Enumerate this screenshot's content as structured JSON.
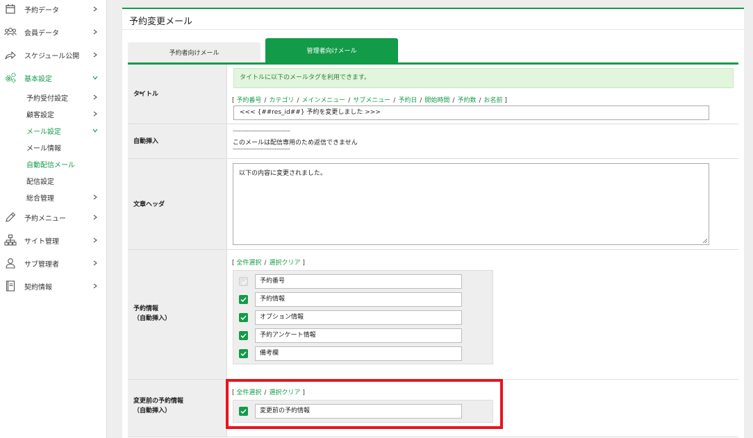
{
  "sidebar": {
    "items": [
      {
        "label": "予約データ",
        "icon": "calendar-icon"
      },
      {
        "label": "会員データ",
        "icon": "users-icon"
      },
      {
        "label": "スケジュール公開",
        "icon": "share-icon"
      },
      {
        "label": "基本設定",
        "icon": "gears-icon"
      },
      {
        "label": "予約メニュー",
        "icon": "pencil-icon"
      },
      {
        "label": "サイト管理",
        "icon": "sitemap-icon"
      },
      {
        "label": "サブ管理者",
        "icon": "user-icon"
      },
      {
        "label": "契約情報",
        "icon": "book-icon"
      }
    ],
    "sub_items": [
      {
        "label": "予約受付設定"
      },
      {
        "label": "顧客設定"
      },
      {
        "label": "メール設定"
      },
      {
        "label": "メール情報"
      },
      {
        "label": "自動配信メール"
      },
      {
        "label": "配信設定"
      },
      {
        "label": "総合管理"
      }
    ]
  },
  "panel": {
    "title": "予約変更メール",
    "tabs": {
      "user": "予約者向けメール",
      "admin": "管理者向けメール"
    }
  },
  "form": {
    "title": {
      "required_mark": "*",
      "label": "タイトル",
      "notice": "タイトルに以下のメールタグを利用できます。",
      "tags": [
        "予約番号",
        "カテゴリ",
        "メインメニュー",
        "サブメニュー",
        "予約日",
        "開始時間",
        "予約数",
        "お名前"
      ],
      "value": "<<< {##res_id##} 予約を変更しました >>>"
    },
    "auto_insert": {
      "label": "自動挿入",
      "dash": "------------------------------",
      "text": "このメールは配信専用のため返信できません"
    },
    "header": {
      "label": "文章ヘッダ",
      "value": "以下の内容に変更されました。"
    },
    "reservation_info": {
      "label_line1": "予約情報",
      "label_line2": "（自動挿入）",
      "select_all": "全件選択",
      "clear": "選択クリア",
      "items": [
        "予約番号",
        "予約情報",
        "オプション情報",
        "予約アンケート情報",
        "備考欄"
      ]
    },
    "before_change": {
      "label_line1": "変更前の予約情報",
      "label_line2": "（自動挿入）",
      "select_all": "全件選択",
      "clear": "選択クリア",
      "items": [
        "変更前の予約情報"
      ]
    }
  },
  "colors": {
    "accent": "#129b48",
    "highlight": "#e8141b"
  }
}
